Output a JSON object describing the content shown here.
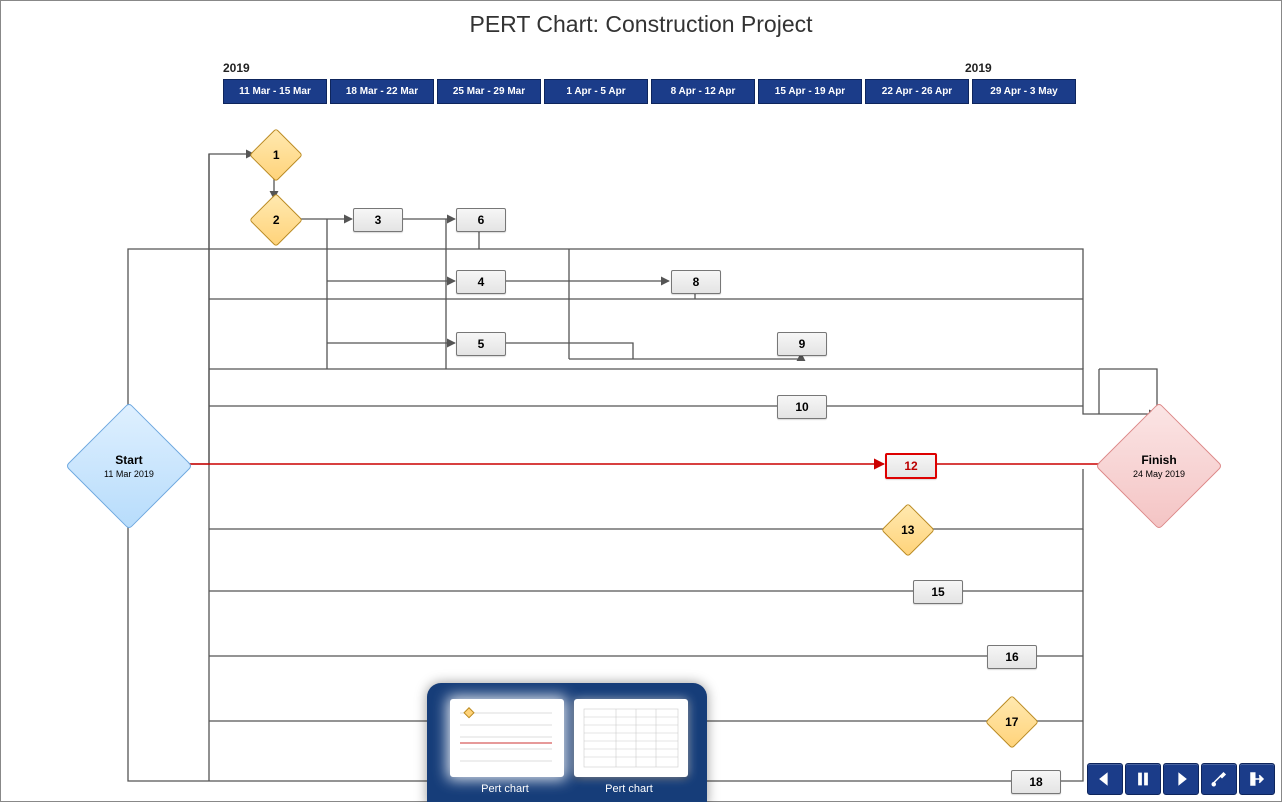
{
  "title": "PERT Chart: Construction Project",
  "timeline": {
    "year_left": "2019",
    "year_right": "2019",
    "weeks": [
      "11 Mar - 15 Mar",
      "18 Mar - 22 Mar",
      "25 Mar - 29 Mar",
      "1 Apr - 5 Apr",
      "8 Apr - 12 Apr",
      "15 Apr - 19 Apr",
      "22 Apr - 26 Apr",
      "29 Apr - 3 May"
    ]
  },
  "start": {
    "title": "Start",
    "date": "11 Mar 2019"
  },
  "finish": {
    "title": "Finish",
    "date": "24 May 2019"
  },
  "nodes": {
    "n1": {
      "label": "1",
      "shape": "diamond"
    },
    "n2": {
      "label": "2",
      "shape": "diamond"
    },
    "n3": {
      "label": "3",
      "shape": "task"
    },
    "n4": {
      "label": "4",
      "shape": "task"
    },
    "n5": {
      "label": "5",
      "shape": "task"
    },
    "n6": {
      "label": "6",
      "shape": "task"
    },
    "n8": {
      "label": "8",
      "shape": "task"
    },
    "n9": {
      "label": "9",
      "shape": "task"
    },
    "n10": {
      "label": "10",
      "shape": "task"
    },
    "n12": {
      "label": "12",
      "shape": "task",
      "critical": true
    },
    "n13": {
      "label": "13",
      "shape": "diamond"
    },
    "n15": {
      "label": "15",
      "shape": "task"
    },
    "n16": {
      "label": "16",
      "shape": "task"
    },
    "n17": {
      "label": "17",
      "shape": "diamond"
    },
    "n18": {
      "label": "18",
      "shape": "task"
    }
  },
  "thumbnails": {
    "t1": "Pert chart",
    "t2": "Pert chart"
  },
  "toolbar_icons": [
    "prev-icon",
    "pause-icon",
    "next-icon",
    "settings-icon",
    "exit-icon"
  ]
}
